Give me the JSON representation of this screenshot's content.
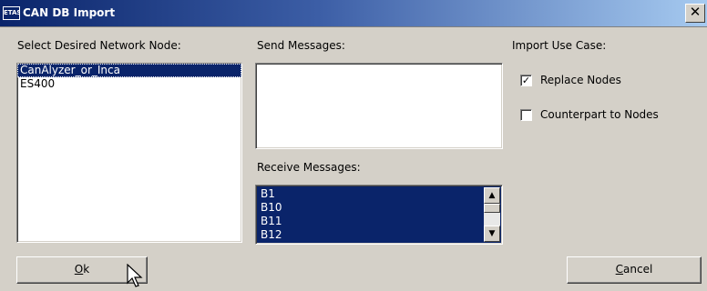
{
  "window": {
    "icon_text": "ETAS",
    "title": "CAN DB Import",
    "close_glyph": "✕"
  },
  "node_panel": {
    "label": "Select Desired Network Node:",
    "items": [
      {
        "label": "CanAlyzer_or_Inca",
        "selected": true
      },
      {
        "label": "ES400",
        "selected": false
      }
    ]
  },
  "send_panel": {
    "label": "Send Messages:",
    "items": []
  },
  "receive_panel": {
    "label": "Receive Messages:",
    "items": [
      "B1",
      "B10",
      "B11",
      "B12"
    ]
  },
  "use_case": {
    "label": "Import Use Case:",
    "options": [
      {
        "label": "Replace Nodes",
        "checked": true
      },
      {
        "label": "Counterpart to Nodes",
        "checked": false
      }
    ]
  },
  "buttons": {
    "ok_mnemonic": "O",
    "ok_rest": "k",
    "cancel_mnemonic": "C",
    "cancel_rest": "ancel"
  },
  "icons": {
    "close": "close-icon",
    "scroll_up": "scroll-up-icon",
    "scroll_down": "scroll-down-icon",
    "checkmark": "checkmark-icon",
    "cursor": "mouse-pointer-icon"
  },
  "colors": {
    "title_start": "#0a246a",
    "title_end": "#a6caf0",
    "selection": "#0a246a",
    "face": "#d4d0c8"
  }
}
